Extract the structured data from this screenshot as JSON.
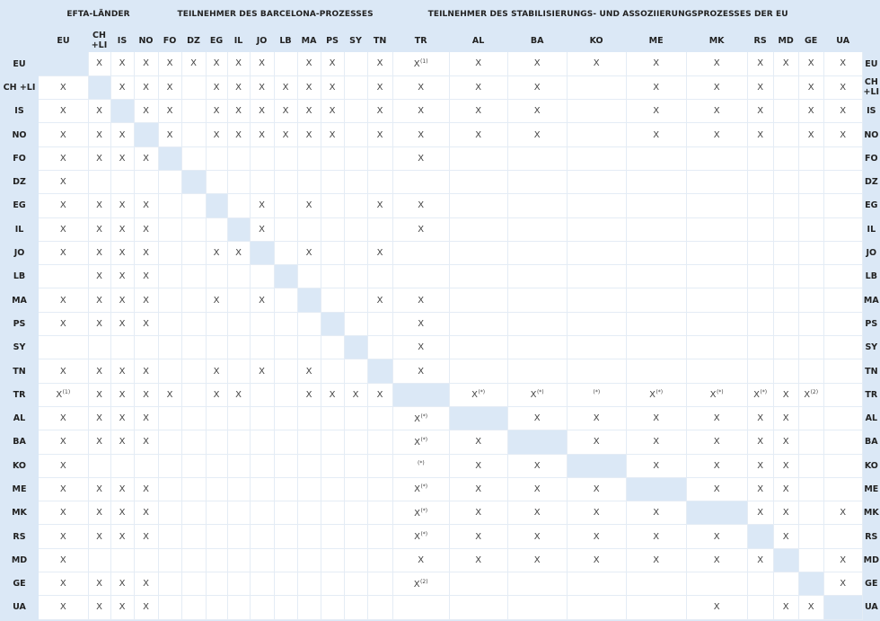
{
  "groups": [
    {
      "label": "",
      "span": 1
    },
    {
      "label": "EFTA-LÄNDER",
      "span": 4
    },
    {
      "label": "TEILNEHMER DES BARCELONA-PROZESSES",
      "span": 10
    },
    {
      "label": "TEILNEHMER DES STABILISIERUNGS- UND ASSOZIIERUNGSPROZESSES DER EU",
      "span": 9
    },
    {
      "label": "",
      "span": 1
    }
  ],
  "columns": [
    "EU",
    "CH +LI",
    "IS",
    "NO",
    "FO",
    "DZ",
    "EG",
    "IL",
    "JO",
    "LB",
    "MA",
    "PS",
    "SY",
    "TN",
    "TR",
    "AL",
    "BA",
    "KO",
    "ME",
    "MK",
    "RS",
    "MD",
    "GE",
    "UA"
  ],
  "rows": [
    {
      "code": "EU",
      "cells": [
        "",
        "X",
        "X",
        "X",
        "X",
        "X",
        "X",
        "X",
        "X",
        "",
        "X",
        "X",
        "",
        "X",
        "X(1)",
        "X",
        "X",
        "X",
        "X",
        "X",
        "X",
        "X",
        "X",
        "X"
      ]
    },
    {
      "code": "CH +LI",
      "cells": [
        "X",
        "",
        "X",
        "X",
        "X",
        "",
        "X",
        "X",
        "X",
        "X",
        "X",
        "X",
        "",
        "X",
        "X",
        "X",
        "X",
        "",
        "X",
        "X",
        "X",
        "",
        "X",
        "X"
      ]
    },
    {
      "code": "IS",
      "cells": [
        "X",
        "X",
        "",
        "X",
        "X",
        "",
        "X",
        "X",
        "X",
        "X",
        "X",
        "X",
        "",
        "X",
        "X",
        "X",
        "X",
        "",
        "X",
        "X",
        "X",
        "",
        "X",
        "X"
      ]
    },
    {
      "code": "NO",
      "cells": [
        "X",
        "X",
        "X",
        "",
        "X",
        "",
        "X",
        "X",
        "X",
        "X",
        "X",
        "X",
        "",
        "X",
        "X",
        "X",
        "X",
        "",
        "X",
        "X",
        "X",
        "",
        "X",
        "X"
      ]
    },
    {
      "code": "FO",
      "cells": [
        "X",
        "X",
        "X",
        "X",
        "",
        "",
        "",
        "",
        "",
        "",
        "",
        "",
        "",
        "",
        "X",
        "",
        "",
        "",
        "",
        "",
        "",
        "",
        "",
        ""
      ]
    },
    {
      "code": "DZ",
      "cells": [
        "X",
        "",
        "",
        "",
        "",
        "",
        "",
        "",
        "",
        "",
        "",
        "",
        "",
        "",
        "",
        "",
        "",
        "",
        "",
        "",
        "",
        "",
        "",
        ""
      ]
    },
    {
      "code": "EG",
      "cells": [
        "X",
        "X",
        "X",
        "X",
        "",
        "",
        "",
        "",
        "X",
        "",
        "X",
        "",
        "",
        "X",
        "X",
        "",
        "",
        "",
        "",
        "",
        "",
        "",
        "",
        ""
      ]
    },
    {
      "code": "IL",
      "cells": [
        "X",
        "X",
        "X",
        "X",
        "",
        "",
        "",
        "",
        "X",
        "",
        "",
        "",
        "",
        "",
        "X",
        "",
        "",
        "",
        "",
        "",
        "",
        "",
        "",
        ""
      ]
    },
    {
      "code": "JO",
      "cells": [
        "X",
        "X",
        "X",
        "X",
        "",
        "",
        "X",
        "X",
        "",
        "",
        "X",
        "",
        "",
        "X",
        "",
        "",
        "",
        "",
        "",
        "",
        "",
        "",
        "",
        ""
      ]
    },
    {
      "code": "LB",
      "cells": [
        "",
        "X",
        "X",
        "X",
        "",
        "",
        "",
        "",
        "",
        "",
        "",
        "",
        "",
        "",
        "",
        "",
        "",
        "",
        "",
        "",
        "",
        "",
        "",
        ""
      ]
    },
    {
      "code": "MA",
      "cells": [
        "X",
        "X",
        "X",
        "X",
        "",
        "",
        "X",
        "",
        "X",
        "",
        "",
        "",
        "",
        "X",
        "X",
        "",
        "",
        "",
        "",
        "",
        "",
        "",
        "",
        ""
      ]
    },
    {
      "code": "PS",
      "cells": [
        "X",
        "X",
        "X",
        "X",
        "",
        "",
        "",
        "",
        "",
        "",
        "",
        "",
        "",
        "",
        "X",
        "",
        "",
        "",
        "",
        "",
        "",
        "",
        "",
        ""
      ]
    },
    {
      "code": "SY",
      "cells": [
        "",
        "",
        "",
        "",
        "",
        "",
        "",
        "",
        "",
        "",
        "",
        "",
        "",
        "",
        "X",
        "",
        "",
        "",
        "",
        "",
        "",
        "",
        "",
        ""
      ]
    },
    {
      "code": "TN",
      "cells": [
        "X",
        "X",
        "X",
        "X",
        "",
        "",
        "X",
        "",
        "X",
        "",
        "X",
        "",
        "",
        "",
        "X",
        "",
        "",
        "",
        "",
        "",
        "",
        "",
        "",
        ""
      ]
    },
    {
      "code": "TR",
      "cells": [
        "X(1)",
        "X",
        "X",
        "X",
        "X",
        "",
        "X",
        "X",
        "",
        "",
        "X",
        "X",
        "X",
        "X",
        "",
        "X(*)",
        "X(*)",
        "(*)",
        "X(*)",
        "X(*)",
        "X(*)",
        "X",
        "X(2)",
        ""
      ]
    },
    {
      "code": "AL",
      "cells": [
        "X",
        "X",
        "X",
        "X",
        "",
        "",
        "",
        "",
        "",
        "",
        "",
        "",
        "",
        "",
        "X(*)",
        "",
        "X",
        "X",
        "X",
        "X",
        "X",
        "X",
        "",
        ""
      ]
    },
    {
      "code": "BA",
      "cells": [
        "X",
        "X",
        "X",
        "X",
        "",
        "",
        "",
        "",
        "",
        "",
        "",
        "",
        "",
        "",
        "X(*)",
        "X",
        "",
        "X",
        "X",
        "X",
        "X",
        "X",
        "",
        ""
      ]
    },
    {
      "code": "KO",
      "cells": [
        "X",
        "",
        "",
        "",
        "",
        "",
        "",
        "",
        "",
        "",
        "",
        "",
        "",
        "",
        "(*)",
        "X",
        "X",
        "",
        "X",
        "X",
        "X",
        "X",
        "",
        ""
      ]
    },
    {
      "code": "ME",
      "cells": [
        "X",
        "X",
        "X",
        "X",
        "",
        "",
        "",
        "",
        "",
        "",
        "",
        "",
        "",
        "",
        "X(*)",
        "X",
        "X",
        "X",
        "",
        "X",
        "X",
        "X",
        "",
        ""
      ]
    },
    {
      "code": "MK",
      "cells": [
        "X",
        "X",
        "X",
        "X",
        "",
        "",
        "",
        "",
        "",
        "",
        "",
        "",
        "",
        "",
        "X(*)",
        "X",
        "X",
        "X",
        "X",
        "",
        "X",
        "X",
        "",
        "X"
      ]
    },
    {
      "code": "RS",
      "cells": [
        "X",
        "X",
        "X",
        "X",
        "",
        "",
        "",
        "",
        "",
        "",
        "",
        "",
        "",
        "",
        "X(*)",
        "X",
        "X",
        "X",
        "X",
        "X",
        "",
        "X",
        "",
        ""
      ]
    },
    {
      "code": "MD",
      "cells": [
        "X",
        "",
        "",
        "",
        "",
        "",
        "",
        "",
        "",
        "",
        "",
        "",
        "",
        "",
        "X",
        "X",
        "X",
        "X",
        "X",
        "X",
        "X",
        "",
        "",
        "X"
      ]
    },
    {
      "code": "GE",
      "cells": [
        "X",
        "X",
        "X",
        "X",
        "",
        "",
        "",
        "",
        "",
        "",
        "",
        "",
        "",
        "",
        "X(2)",
        "",
        "",
        "",
        "",
        "",
        "",
        "",
        "",
        "X"
      ]
    },
    {
      "code": "UA",
      "cells": [
        "X",
        "X",
        "X",
        "X",
        "",
        "",
        "",
        "",
        "",
        "",
        "",
        "",
        "",
        "",
        "",
        "",
        "",
        "",
        "",
        "X",
        "",
        "X",
        "X",
        ""
      ]
    }
  ]
}
